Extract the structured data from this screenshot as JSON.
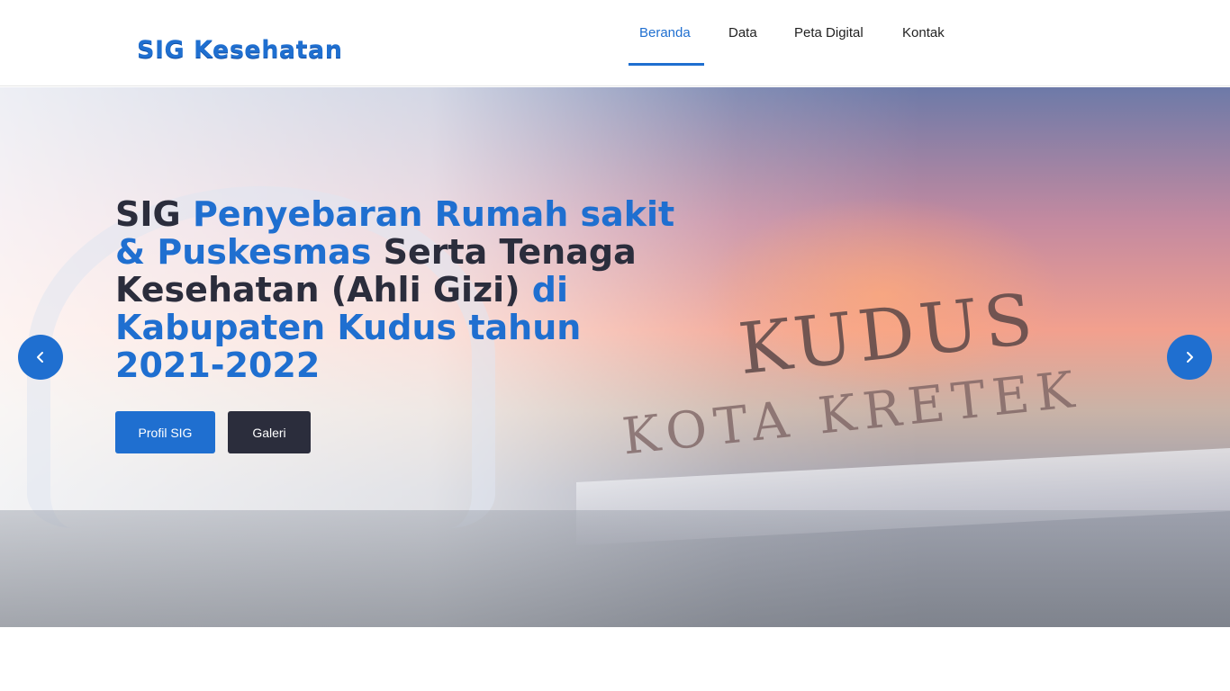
{
  "header": {
    "logo_text": "SIG Kesehatan",
    "nav": [
      {
        "label": "Beranda",
        "active": true
      },
      {
        "label": "Data",
        "active": false
      },
      {
        "label": "Peta Digital",
        "active": false
      },
      {
        "label": "Kontak",
        "active": false
      }
    ]
  },
  "hero": {
    "title_parts": {
      "p1": "SIG ",
      "p2": "Penyebaran Rumah sakit & Puskesmas",
      "p3": " Serta Tenaga Kesehatan (Ahli Gizi) ",
      "p4": "di Kabupaten Kudus tahun 2021-2022"
    },
    "sign_line1": "KUDUS",
    "sign_line2": "KOTA KRETEK",
    "buttons": {
      "profil": "Profil SIG",
      "galeri": "Galeri"
    },
    "prev_icon": "chevron-left-icon",
    "next_icon": "chevron-right-icon"
  },
  "colors": {
    "accent": "#1f6fd0",
    "dark": "#2b2d3c"
  }
}
